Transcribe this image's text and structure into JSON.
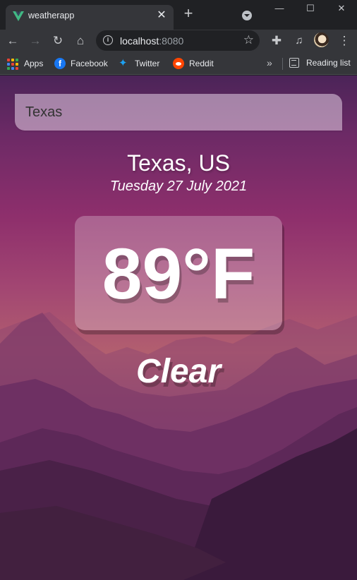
{
  "browser": {
    "tab": {
      "title": "weatherapp",
      "close_glyph": "✕"
    },
    "new_tab_glyph": "+",
    "address": {
      "host": "localhost",
      "port": ":8080"
    },
    "bookmarks": [
      {
        "label": "Apps",
        "icon": "apps-grid-icon"
      },
      {
        "label": "Facebook",
        "icon": "facebook-icon"
      },
      {
        "label": "Twitter",
        "icon": "twitter-icon"
      },
      {
        "label": "Reddit",
        "icon": "reddit-icon"
      }
    ],
    "more_glyph": "»",
    "reading_list_label": "Reading list"
  },
  "app": {
    "search": {
      "value": "Texas",
      "placeholder": "Search..."
    },
    "location": "Texas, US",
    "date": "Tuesday 27 July 2021",
    "temperature": "89°F",
    "weather": "Clear"
  },
  "colors": {
    "accent": "#8e2f6c",
    "sky_top": "#4b2458",
    "horizon": "#b25f6f"
  }
}
